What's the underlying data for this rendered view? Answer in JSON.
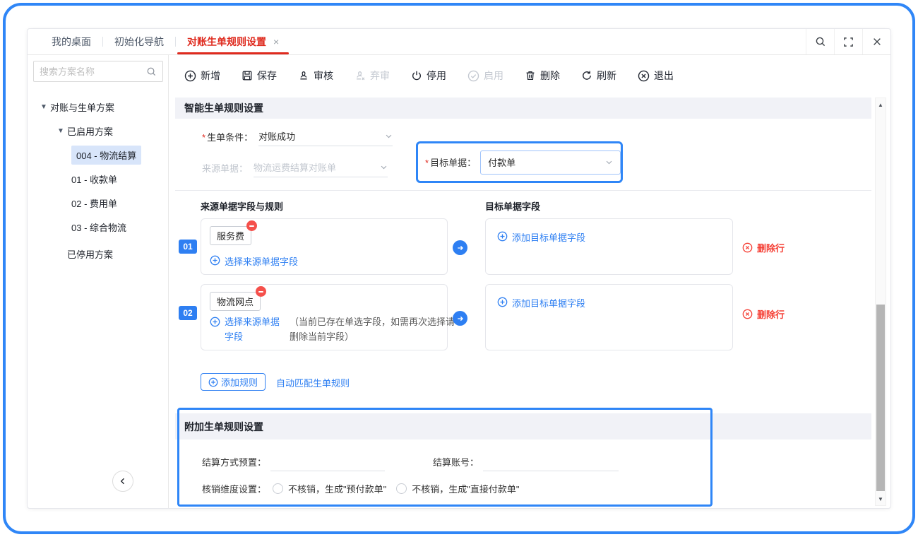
{
  "header": {
    "tabs": [
      {
        "label": "我的桌面"
      },
      {
        "label": "初始化导航"
      },
      {
        "label": "对账生单规则设置",
        "close": "×"
      }
    ]
  },
  "sidebar": {
    "search_placeholder": "搜索方案名称",
    "tree": [
      {
        "label": "对账与生单方案"
      },
      {
        "label": "已启用方案"
      },
      {
        "label": "004 - 物流结算",
        "selected": true
      },
      {
        "label": "01 - 收款单"
      },
      {
        "label": "02 - 费用单"
      },
      {
        "label": "03 - 综合物流"
      },
      {
        "label": "已停用方案"
      }
    ]
  },
  "toolbar": {
    "buttons": [
      {
        "label": "新增",
        "icon": "plus-circle-icon",
        "disabled": false
      },
      {
        "label": "保存",
        "icon": "save-icon",
        "disabled": false
      },
      {
        "label": "审核",
        "icon": "stamp-icon",
        "disabled": false
      },
      {
        "label": "弃审",
        "icon": "stamp-x-icon",
        "disabled": true
      },
      {
        "label": "停用",
        "icon": "power-icon",
        "disabled": false
      },
      {
        "label": "启用",
        "icon": "check-circle-icon",
        "disabled": true
      },
      {
        "label": "删除",
        "icon": "trash-icon",
        "disabled": false
      },
      {
        "label": "刷新",
        "icon": "refresh-icon",
        "disabled": false
      },
      {
        "label": "退出",
        "icon": "exit-icon",
        "disabled": false
      }
    ]
  },
  "smart": {
    "title": "智能生单规则设置",
    "required_mark": "*",
    "condition_label": "生单条件：",
    "condition_value": "对账成功",
    "source_label": "来源单据：",
    "source_value": "物流运费结算对账单",
    "target_label": "目标单据：",
    "target_value": "付款单",
    "col_source": "来源单据字段与规则",
    "col_target": "目标单据字段",
    "rules": [
      {
        "no": "01",
        "tag": "服务费",
        "pick": "选择来源单据字段",
        "note": "",
        "add_target": "添加目标单据字段",
        "del": "删除行"
      },
      {
        "no": "02",
        "tag": "物流网点",
        "pick": "选择来源单据字段",
        "note": "（当前已存在单选字段，如需再次选择请删除当前字段）",
        "add_target": "添加目标单据字段",
        "del": "删除行"
      }
    ],
    "add_rule": "添加规则",
    "auto_match": "自动匹配生单规则"
  },
  "extra": {
    "title": "附加生单规则设置",
    "settle_method_label": "结算方式预置：",
    "settle_account_label": "结算账号：",
    "verify_label": "核销维度设置：",
    "radio1": "不核销，生成\"预付款单\"",
    "radio2": "不核销，生成\"直接付款单\""
  }
}
